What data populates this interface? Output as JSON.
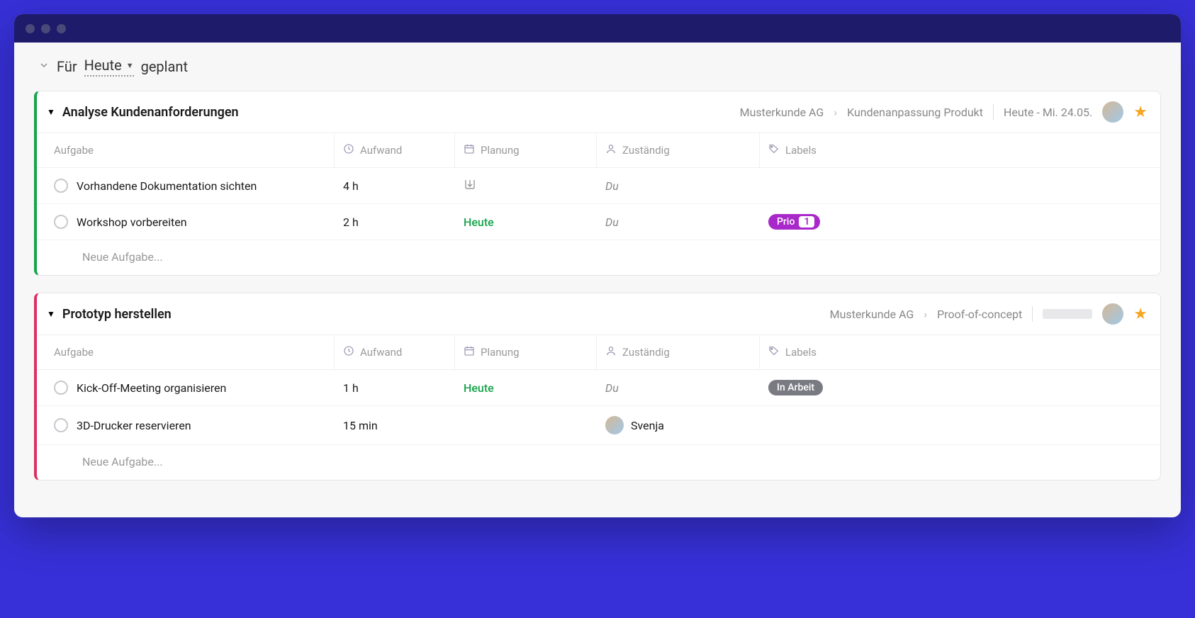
{
  "filter": {
    "prefix": "Für",
    "dropdown": "Heute",
    "suffix": "geplant"
  },
  "columns": {
    "task": "Aufgabe",
    "effort": "Aufwand",
    "planning": "Planung",
    "assignee": "Zuständig",
    "labels": "Labels"
  },
  "new_task_placeholder": "Neue Aufgabe...",
  "cards": [
    {
      "title": "Analyse Kundenanforderungen",
      "breadcrumb": {
        "org": "Musterkunde AG",
        "project": "Kundenanpassung Produkt"
      },
      "date": "Heute - Mi. 24.05.",
      "accent": "green",
      "rows": [
        {
          "task": "Vorhandene Dokumentation sichten",
          "effort": "4 h",
          "planning_icon": true,
          "planning_text": "",
          "assignee": {
            "you": true,
            "label": "Du"
          },
          "labels": []
        },
        {
          "task": "Workshop vorbereiten",
          "effort": "2 h",
          "planning_icon": false,
          "planning_text": "Heute",
          "planning_today": true,
          "assignee": {
            "you": true,
            "label": "Du"
          },
          "labels": [
            {
              "text": "Prio",
              "count": "1",
              "variant": "purple"
            }
          ]
        }
      ]
    },
    {
      "title": "Prototyp herstellen",
      "breadcrumb": {
        "org": "Musterkunde AG",
        "project": "Proof-of-concept"
      },
      "date": "",
      "accent": "red",
      "has_placeholder_bar": true,
      "rows": [
        {
          "task": "Kick-Off-Meeting organisieren",
          "effort": "1 h",
          "planning_icon": false,
          "planning_text": "Heute",
          "planning_today": true,
          "assignee": {
            "you": true,
            "label": "Du"
          },
          "labels": [
            {
              "text": "In Arbeit",
              "variant": "gray"
            }
          ]
        },
        {
          "task": "3D-Drucker reservieren",
          "effort": "15 min",
          "planning_icon": false,
          "planning_text": "",
          "assignee": {
            "you": false,
            "label": "Svenja"
          },
          "labels": []
        }
      ]
    }
  ]
}
